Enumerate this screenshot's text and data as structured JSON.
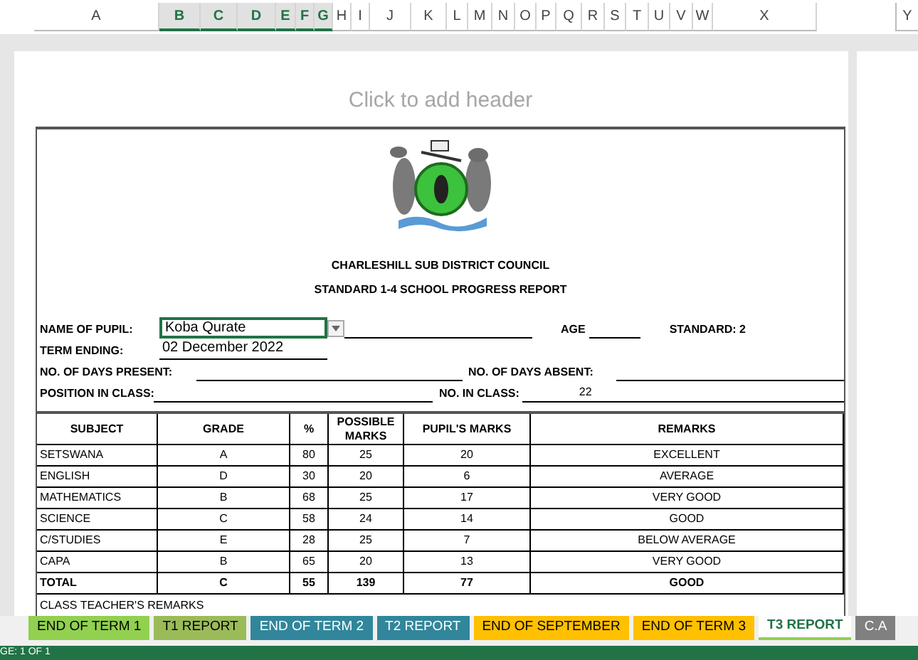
{
  "columns": [
    {
      "label": "A",
      "selected": false
    },
    {
      "label": "B",
      "selected": true
    },
    {
      "label": "C",
      "selected": true
    },
    {
      "label": "D",
      "selected": true
    },
    {
      "label": "E",
      "selected": true
    },
    {
      "label": "F",
      "selected": true
    },
    {
      "label": "G",
      "selected": true
    },
    {
      "label": "H",
      "selected": false
    },
    {
      "label": "I",
      "selected": false
    },
    {
      "label": "J",
      "selected": false
    },
    {
      "label": "K",
      "selected": false
    },
    {
      "label": "L",
      "selected": false
    },
    {
      "label": "M",
      "selected": false
    },
    {
      "label": "N",
      "selected": false
    },
    {
      "label": "O",
      "selected": false
    },
    {
      "label": "P",
      "selected": false
    },
    {
      "label": "Q",
      "selected": false
    },
    {
      "label": "R",
      "selected": false
    },
    {
      "label": "S",
      "selected": false
    },
    {
      "label": "T",
      "selected": false
    },
    {
      "label": "U",
      "selected": false
    },
    {
      "label": "V",
      "selected": false
    },
    {
      "label": "W",
      "selected": false
    },
    {
      "label": "X",
      "selected": false
    }
  ],
  "next_page_column": "Y",
  "page_header_placeholder": "Click to add header",
  "report": {
    "council": "CHARLESHILL SUB DISTRICT COUNCIL",
    "title": "STANDARD 1-4 SCHOOL PROGRESS REPORT",
    "name_label": "NAME OF PUPIL:",
    "name_value": "Koba Qurate",
    "age_label": "AGE",
    "standard": "STANDARD: 2",
    "term_label": "TERM ENDING:",
    "term_value": "02 December 2022",
    "present_label": "NO. OF DAYS PRESENT:",
    "absent_label": "NO. OF DAYS ABSENT:",
    "position_label": "POSITION IN CLASS:",
    "class_size_label": "NO. IN CLASS:",
    "class_size_value": "22"
  },
  "table": {
    "columns": [
      "SUBJECT",
      "GRADE",
      "%",
      "POSSIBLE MARKS",
      "PUPIL'S MARKS",
      "REMARKS"
    ],
    "rows": [
      {
        "kind": "subject",
        "cells": [
          "SETSWANA",
          "A",
          "80",
          "25",
          "20",
          "EXCELLENT"
        ]
      },
      {
        "kind": "subject",
        "cells": [
          "ENGLISH",
          "D",
          "30",
          "20",
          "6",
          "AVERAGE"
        ]
      },
      {
        "kind": "subject",
        "cells": [
          "MATHEMATICS",
          "B",
          "68",
          "25",
          "17",
          "VERY GOOD"
        ]
      },
      {
        "kind": "subject",
        "cells": [
          "SCIENCE",
          "C",
          "58",
          "24",
          "14",
          "GOOD"
        ]
      },
      {
        "kind": "subject",
        "cells": [
          "C/STUDIES",
          "E",
          "28",
          "25",
          "7",
          "BELOW AVERAGE"
        ]
      },
      {
        "kind": "subject",
        "cells": [
          "CAPA",
          "B",
          "65",
          "20",
          "13",
          "VERY GOOD"
        ]
      },
      {
        "kind": "total",
        "cells": [
          "TOTAL",
          "C",
          "55",
          "139",
          "77",
          "GOOD"
        ]
      }
    ]
  },
  "teacher_remarks_label": "CLASS TEACHER'S REMARKS",
  "sheet_tabs": [
    {
      "label": "END OF TERM 1",
      "color": "#92d050",
      "selected": false
    },
    {
      "label": "T1 REPORT",
      "color": "#9bbb59",
      "selected": false
    },
    {
      "label": "END OF TERM 2",
      "color": "#31869b",
      "selected": false
    },
    {
      "label": "T2 REPORT",
      "color": "#31869b",
      "selected": false
    },
    {
      "label": "END OF SEPTEMBER",
      "color": "#ffc000",
      "selected": false
    },
    {
      "label": "END OF TERM 3",
      "color": "#ffc000",
      "selected": false
    },
    {
      "label": "T3 REPORT",
      "color": "#92d050",
      "selected": true
    },
    {
      "label": "C.A",
      "color": "#808080",
      "selected": false
    }
  ],
  "status_bar": "GE: 1 OF 1"
}
